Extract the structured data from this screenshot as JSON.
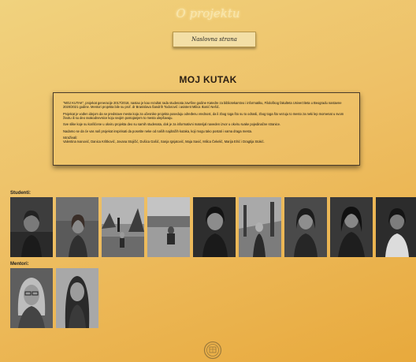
{
  "header": {
    "logo_text": "O projektu",
    "home_button_label": "Naslovna strana"
  },
  "page_title": "MOJ KUTAK",
  "about": {
    "paragraphs": [
      "\"MOJ KUTAK\", projekat generacije 2017/2018, nastao je kao rezultat rada studenata završne godine Katedre za bibliotekarstvo i informatiku, Filološkog fakulteta Univerziteta u Beogradu nastavne 2020/2021 godine. Mentori projekta bile su prof. dr Branislava Šandrih Todorović i asistent Milica Ikonić Nešić.",
      "Projekat je vođen idejom da se predstave mesta koja za učesnike projekta poseduju određenu vrednost, da li zbog toga što su to odrasli, zbog toga što vezuju to mesto za neki lep momenat u svom životu ili su deo svakodnevnice koju svojim postojanjem to mesta ulepšavaju.",
      "Sve slike koje su korišćene u okviru projekta deo su samih studenata, dok je za informativni materijal naveden izvor u okviru svake pojedinačne stranice.",
      "Nadamo se da će vas naš projekat inspirisati da posetite neke od naših najdražih kutaka, koji mogu tako postati i vama draga mesta."
    ],
    "authors_heading": "Istraživali:",
    "authors": "Valentina Ivanović, Danica Krštković, Jovana Stojičić, Dušica Gašić, Sanja Ignjatović, Maja Savić, Milica Čekelić, Marija Elrić i Dragtija Stokić."
  },
  "students": {
    "label": "Studenti:",
    "photos": [
      {
        "icon": "student-portrait"
      },
      {
        "icon": "student-portrait"
      },
      {
        "icon": "student-outdoor"
      },
      {
        "icon": "student-lake"
      },
      {
        "icon": "student-portrait"
      },
      {
        "icon": "student-outdoor"
      },
      {
        "icon": "student-portrait"
      },
      {
        "icon": "student-portrait"
      },
      {
        "icon": "student-portrait"
      }
    ]
  },
  "mentors": {
    "label": "Mentori:",
    "photos": [
      {
        "icon": "mentor-portrait"
      },
      {
        "icon": "mentor-portrait"
      }
    ]
  },
  "footer": {
    "seal_icon": "university-seal-icon"
  },
  "colors": {
    "background_top": "#f0d27e",
    "background_bottom": "#e8a93c",
    "button_bg": "#f3dfa6",
    "logo_glow": "#f8e6ad"
  }
}
